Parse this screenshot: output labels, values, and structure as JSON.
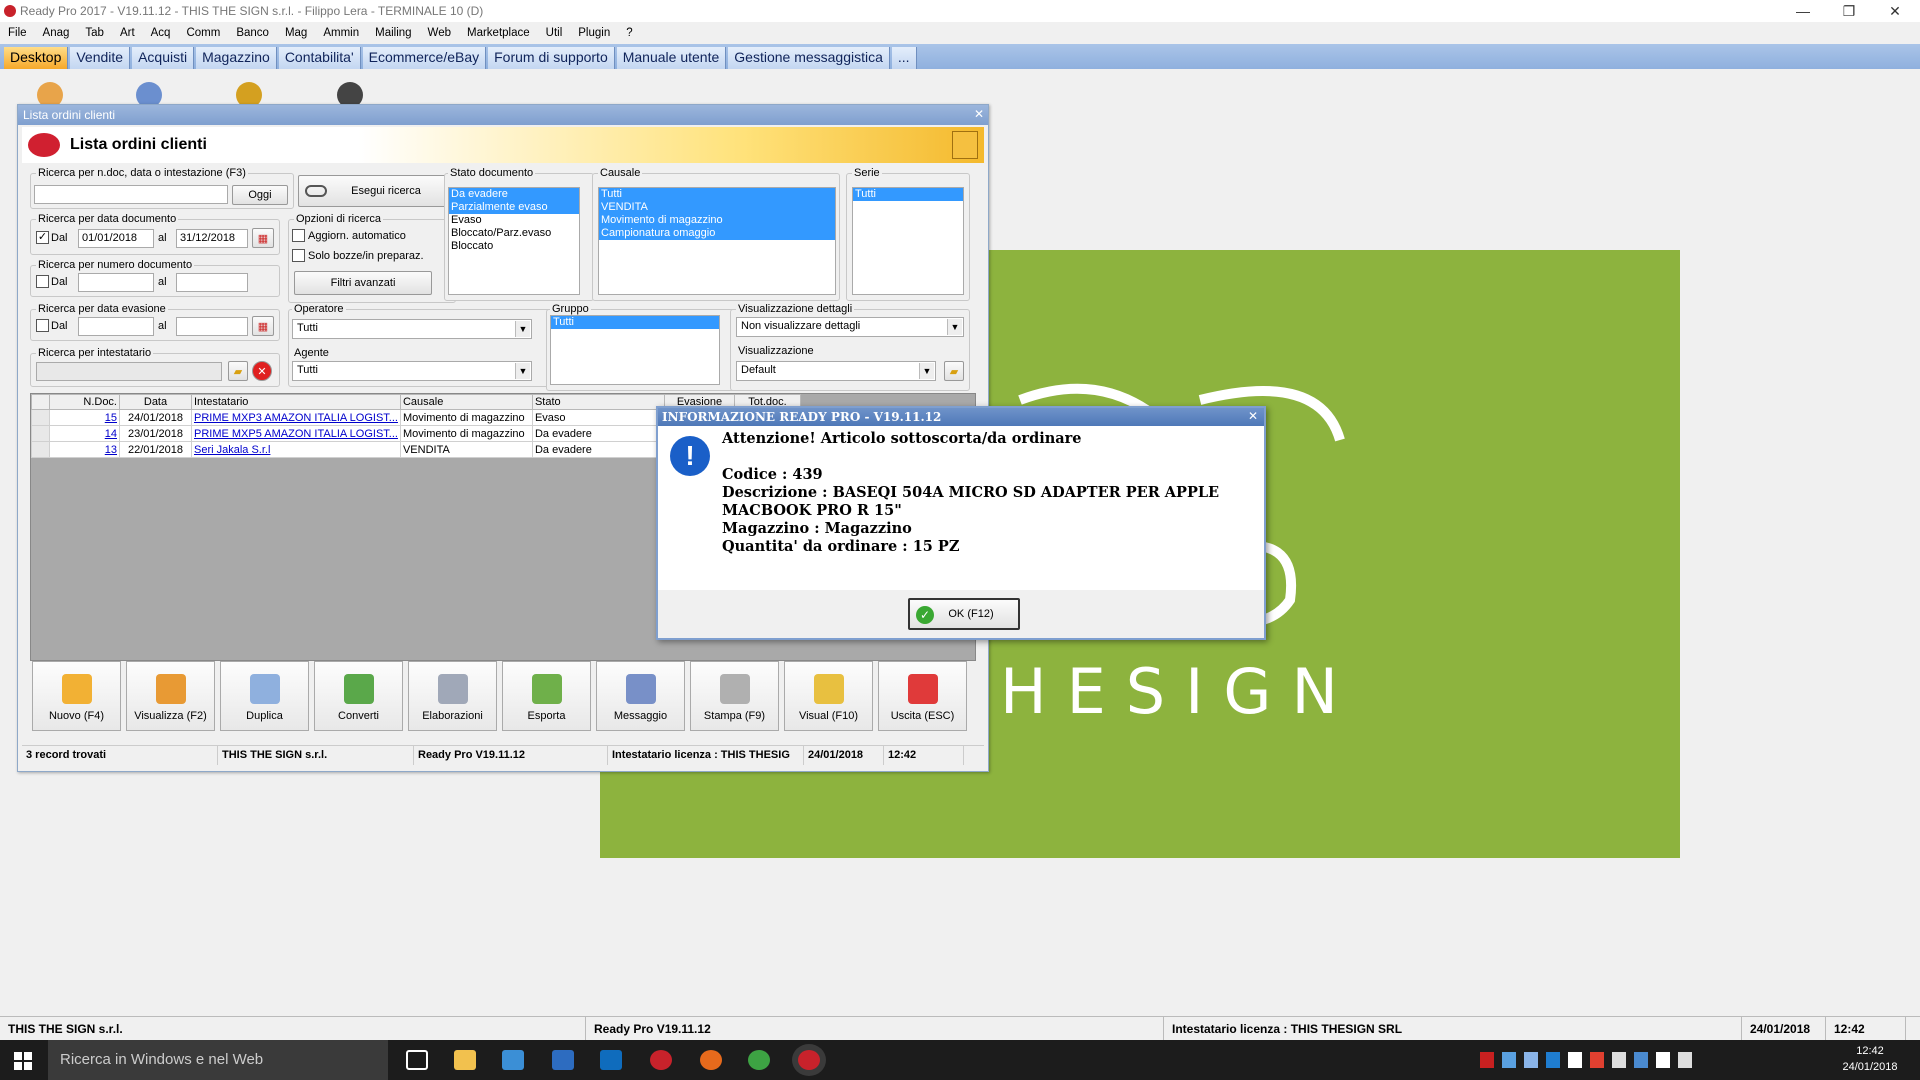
{
  "app": {
    "title": "Ready Pro 2017 - V19.11.12 - THIS THE SIGN s.r.l. - Filippo Lera - TERMINALE 10 (D)"
  },
  "menu": [
    "File",
    "Anag",
    "Tab",
    "Art",
    "Acq",
    "Comm",
    "Banco",
    "Mag",
    "Ammin",
    "Mailing",
    "Web",
    "Marketplace",
    "Util",
    "Plugin",
    "?"
  ],
  "tabs": [
    "Desktop",
    "Vendite",
    "Acquisti",
    "Magazzino",
    "Contabilita'",
    "Ecommerce/eBay",
    "Forum di supporto",
    "Manuale utente",
    "Gestione messaggistica",
    "..."
  ],
  "background": {
    "brand": "HESIGN",
    "accent": "#8db33e"
  },
  "window": {
    "title": "Lista ordini clienti",
    "heading": "Lista ordini clienti",
    "search_label": "Ricerca per n.doc, data o intestazione (F3)",
    "oggi": "Oggi",
    "esegui": "Esegui ricerca",
    "data_doc_label": "Ricerca per data documento",
    "dal": "Dal",
    "al": "al",
    "date_from": "01/01/2018",
    "date_to": "31/12/2018",
    "num_doc_label": "Ricerca per numero documento",
    "data_evas_label": "Ricerca per data evasione",
    "intestatario_label": "Ricerca per intestatario",
    "opzioni_label": "Opzioni di ricerca",
    "aggiorn": "Aggiorn. automatico",
    "solo_bozze": "Solo bozze/in preparaz.",
    "filtri": "Filtri avanzati",
    "operatore_label": "Operatore",
    "operatore_val": "Tutti",
    "agente_label": "Agente",
    "agente_val": "Tutti",
    "stato_label": "Stato documento",
    "stato": [
      "Da evadere",
      "Parzialmente evaso",
      "Evaso",
      "Bloccato/Parz.evaso",
      "Bloccato"
    ],
    "causale_label": "Causale",
    "causale": [
      "Tutti",
      "VENDITA",
      "Movimento di magazzino",
      "Campionatura omaggio"
    ],
    "serie_label": "Serie",
    "serie": [
      "Tutti"
    ],
    "gruppo_label": "Gruppo",
    "gruppo": [
      "Tutti"
    ],
    "vis_det_label": "Visualizzazione dettagli",
    "vis_det_val": "Non visualizzare dettagli",
    "vis_label": "Visualizzazione",
    "vis_val": "Default",
    "columns": [
      "N.Doc.",
      "Data",
      "Intestatario",
      "Causale",
      "Stato",
      "Evasione",
      "Tot.doc."
    ],
    "rows": [
      {
        "n": "15",
        "data": "24/01/2018",
        "int": "PRIME MXP3 AMAZON ITALIA LOGIST...",
        "caus": "Movimento di magazzino",
        "stato": "Evaso"
      },
      {
        "n": "14",
        "data": "23/01/2018",
        "int": "PRIME MXP5 AMAZON ITALIA LOGIST...",
        "caus": "Movimento di magazzino",
        "stato": "Da evadere"
      },
      {
        "n": "13",
        "data": "22/01/2018",
        "int": "Seri Jakala S.r.l",
        "caus": "VENDITA",
        "stato": "Da evadere"
      }
    ],
    "actions": [
      "Nuovo (F4)",
      "Visualizza (F2)",
      "Duplica",
      "Converti",
      "Elaborazioni",
      "Esporta",
      "Messaggio",
      "Stampa (F9)",
      "Visual (F10)",
      "Uscita (ESC)"
    ],
    "status": [
      "3 record trovati",
      "THIS THE SIGN s.r.l.",
      "Ready Pro V19.11.12",
      "Intestatario licenza : THIS THESIG",
      "24/01/2018",
      "12:42"
    ]
  },
  "dialog": {
    "title": "INFORMAZIONE READY PRO - V19.11.12",
    "line1": "Attenzione! Articolo sottoscorta/da ordinare",
    "codice": "Codice : 439",
    "descr": "Descrizione : BASEQI 504A MICRO SD ADAPTER PER APPLE MACBOOK PRO R 15\"",
    "mag": "Magazzino : Magazzino",
    "qta": "Quantita' da ordinare : 15 PZ",
    "ok": "OK (F12)"
  },
  "appstatus": [
    "THIS THE SIGN s.r.l.",
    "Ready Pro V19.11.12",
    "Intestatario licenza : THIS THESIGN SRL",
    "24/01/2018",
    "12:42"
  ],
  "taskbar": {
    "search": "Ricerca in Windows e nel Web",
    "time": "12:42",
    "date": "24/01/2018"
  }
}
